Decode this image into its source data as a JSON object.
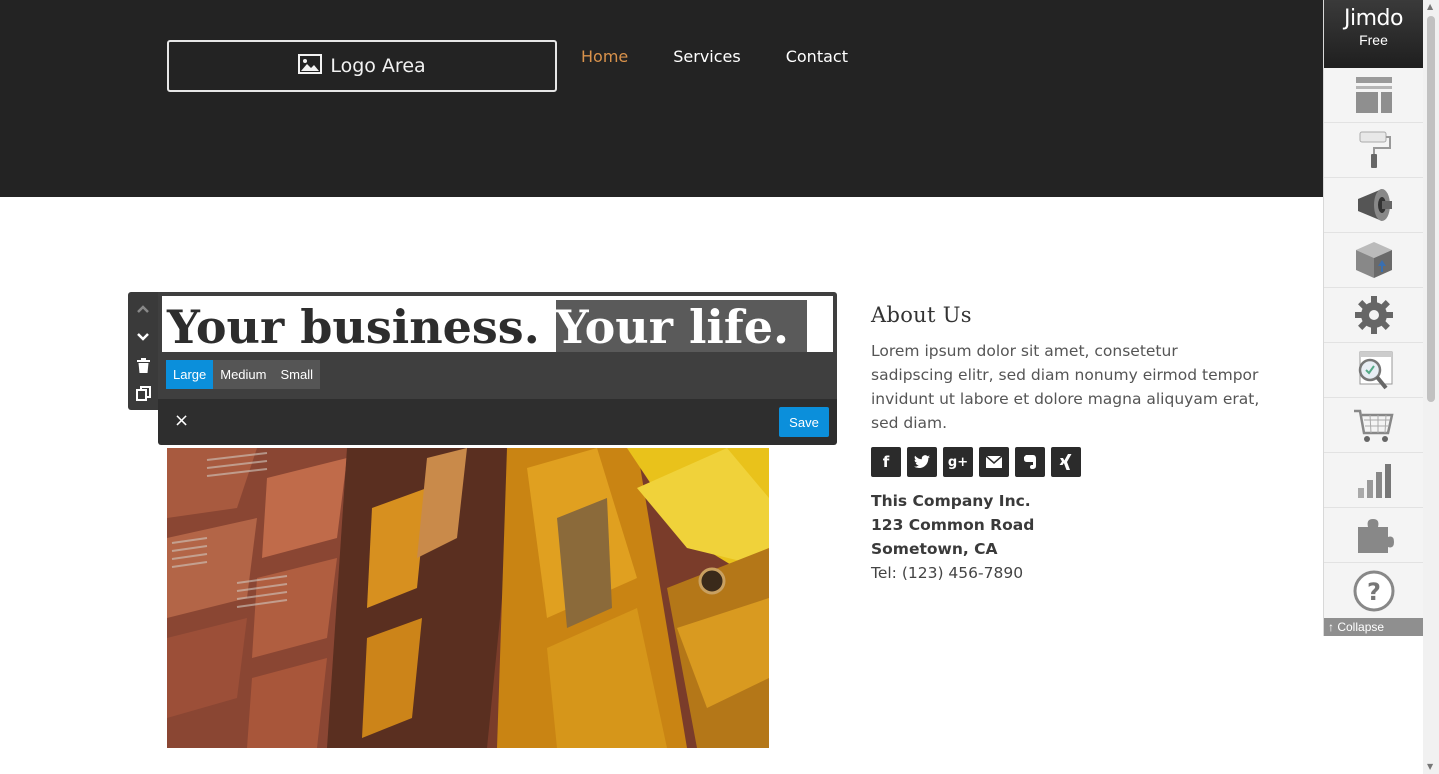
{
  "header": {
    "logo_label": "Logo Area",
    "nav": [
      {
        "label": "Home",
        "active": true
      },
      {
        "label": "Services",
        "active": false
      },
      {
        "label": "Contact",
        "active": false
      }
    ],
    "active_color": "#d9924b"
  },
  "editor": {
    "headline_part1": "Your business. ",
    "headline_part2": "Your life.",
    "size_options": [
      "Large",
      "Medium",
      "Small"
    ],
    "selected_size": "Large",
    "close_label": "×",
    "save_label": "Save",
    "accent_color": "#0b8fdb"
  },
  "about": {
    "title": "About Us",
    "body": "Lorem ipsum dolor sit amet, consetetur sadipscing elitr, sed diam nonumy eirmod tempor invidunt ut labore et dolore magna aliquyam erat, sed diam.",
    "social_icons": [
      "facebook-icon",
      "twitter-icon",
      "google-plus-icon",
      "email-icon",
      "evernote-icon",
      "xing-icon"
    ],
    "address_lines": [
      "This Company Inc.",
      "123 Common Road",
      "Sometown, CA"
    ],
    "tel": "Tel: (123) 456-7890"
  },
  "jimdo": {
    "brand": "Jimdo",
    "plan": "Free",
    "tools": [
      "layout-icon",
      "paint-roller-icon",
      "megaphone-icon",
      "package-icon",
      "settings-gear-icon",
      "seo-magnifier-icon",
      "shopping-cart-icon",
      "statistics-icon",
      "puzzle-icon",
      "help-icon"
    ],
    "collapse_label": "Collapse"
  }
}
